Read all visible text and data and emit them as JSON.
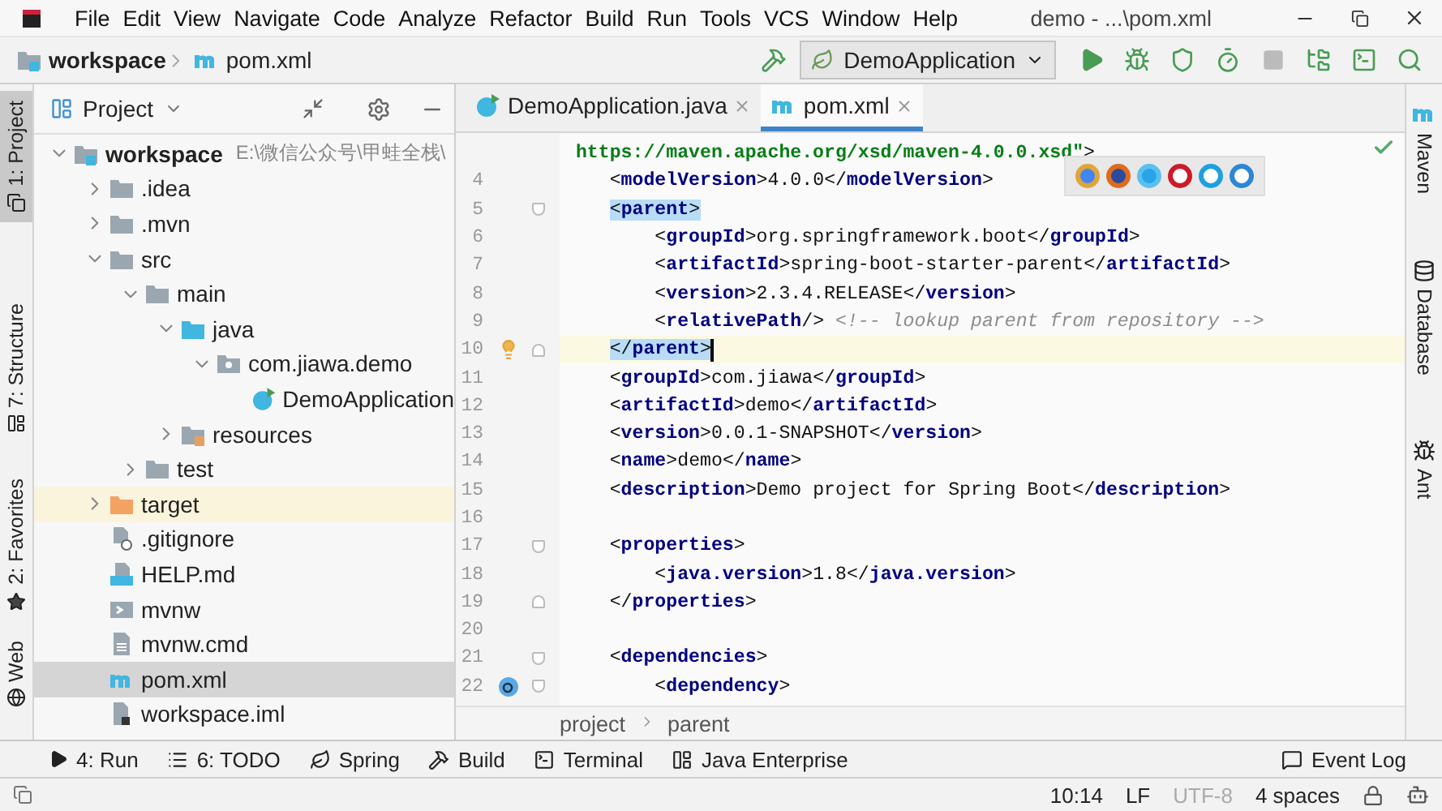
{
  "window": {
    "title": "demo - ...\\pom.xml"
  },
  "menu": [
    "File",
    "Edit",
    "View",
    "Navigate",
    "Code",
    "Analyze",
    "Refactor",
    "Build",
    "Run",
    "Tools",
    "VCS",
    "Window",
    "Help"
  ],
  "breadcrumb": [
    {
      "label": "workspace",
      "kind": "module"
    },
    {
      "label": "pom.xml",
      "kind": "maven"
    }
  ],
  "run_config": {
    "label": "DemoApplication"
  },
  "toolbar": [
    {
      "kind": "run",
      "disabled": false
    },
    {
      "kind": "debug",
      "disabled": false
    },
    {
      "kind": "coverage",
      "disabled": false
    },
    {
      "kind": "profile",
      "disabled": false
    },
    {
      "kind": "stop",
      "disabled": true
    },
    {
      "kind": "structure",
      "disabled": false
    },
    {
      "kind": "terminal",
      "disabled": false
    },
    {
      "kind": "search",
      "disabled": false
    }
  ],
  "left_stripe": [
    {
      "label": "1: Project",
      "selected": true
    },
    {
      "label": "7: Structure",
      "selected": false
    },
    {
      "label": "2: Favorites",
      "selected": false
    },
    {
      "label": "Web",
      "selected": false
    }
  ],
  "right_stripe": [
    {
      "label": "Maven",
      "kind": "maven"
    },
    {
      "label": "Database",
      "kind": "database"
    },
    {
      "label": "Ant",
      "kind": "ant"
    }
  ],
  "project_panel": {
    "title": "Project",
    "tree": [
      {
        "label": "workspace",
        "path": "E:\\微信公众号\\甲蛙全栈\\",
        "kind": "module",
        "expanded": true,
        "selected": false,
        "children": [
          {
            "label": ".idea",
            "kind": "folder",
            "expanded": false,
            "selected": false
          },
          {
            "label": ".mvn",
            "kind": "folder",
            "expanded": false,
            "selected": false
          },
          {
            "label": "src",
            "kind": "folder",
            "expanded": true,
            "selected": false,
            "children": [
              {
                "label": "main",
                "kind": "folder",
                "expanded": true,
                "selected": false,
                "children": [
                  {
                    "label": "java",
                    "kind": "source",
                    "expanded": true,
                    "selected": false,
                    "children": [
                      {
                        "label": "com.jiawa.demo",
                        "kind": "package",
                        "expanded": true,
                        "selected": false,
                        "children": [
                          {
                            "label": "DemoApplication",
                            "kind": "class",
                            "selected": false
                          }
                        ]
                      }
                    ]
                  },
                  {
                    "label": "resources",
                    "kind": "resources",
                    "expanded": false,
                    "selected": false
                  }
                ]
              },
              {
                "label": "test",
                "kind": "folder",
                "expanded": false,
                "selected": false
              }
            ]
          },
          {
            "label": "target",
            "kind": "excluded",
            "expanded": false,
            "selected": false
          },
          {
            "label": ".gitignore",
            "kind": "ignore",
            "selected": false
          },
          {
            "label": "HELP.md",
            "kind": "markdown",
            "selected": false
          },
          {
            "label": "mvnw",
            "kind": "script",
            "selected": false
          },
          {
            "label": "mvnw.cmd",
            "kind": "file",
            "selected": false
          },
          {
            "label": "pom.xml",
            "kind": "maven",
            "selected": true
          },
          {
            "label": "workspace.iml",
            "kind": "iml",
            "selected": false
          }
        ]
      }
    ]
  },
  "editor_tabs": [
    {
      "label": "DemoApplication.java",
      "kind": "class",
      "selected": false
    },
    {
      "label": "pom.xml",
      "kind": "maven",
      "selected": true
    }
  ],
  "code_lines": [
    {
      "segments": [
        {
          "kind": "string",
          "text": " https://maven.apache.org/xsd/maven-4.0.0.xsd\""
        },
        {
          "kind": "punct",
          "text": ">"
        }
      ]
    },
    {
      "number": "4",
      "segments": [
        {
          "kind": "punct",
          "text": "    <"
        },
        {
          "kind": "tag",
          "text": "modelVersion"
        },
        {
          "kind": "punct",
          "text": ">"
        },
        {
          "kind": "text",
          "text": "4.0.0"
        },
        {
          "kind": "punct",
          "text": "</"
        },
        {
          "kind": "tag",
          "text": "modelVersion"
        },
        {
          "kind": "punct",
          "text": ">"
        }
      ]
    },
    {
      "number": "5",
      "fold_start": true,
      "segments": [
        {
          "kind": "punct",
          "text": "    <",
          "matched": true
        },
        {
          "kind": "tag",
          "text": "parent",
          "matched": true
        },
        {
          "kind": "punct",
          "text": ">",
          "matched": true
        }
      ]
    },
    {
      "number": "6",
      "segments": [
        {
          "kind": "punct",
          "text": "        <"
        },
        {
          "kind": "tag",
          "text": "groupId"
        },
        {
          "kind": "punct",
          "text": ">"
        },
        {
          "kind": "text",
          "text": "org.springframework.boot"
        },
        {
          "kind": "punct",
          "text": "</"
        },
        {
          "kind": "tag",
          "text": "groupId"
        },
        {
          "kind": "punct",
          "text": ">"
        }
      ]
    },
    {
      "number": "7",
      "segments": [
        {
          "kind": "punct",
          "text": "        <"
        },
        {
          "kind": "tag",
          "text": "artifactId"
        },
        {
          "kind": "punct",
          "text": ">"
        },
        {
          "kind": "text",
          "text": "spring-boot-starter-parent"
        },
        {
          "kind": "punct",
          "text": "</"
        },
        {
          "kind": "tag",
          "text": "artifactId"
        },
        {
          "kind": "punct",
          "text": ">"
        }
      ]
    },
    {
      "number": "8",
      "segments": [
        {
          "kind": "punct",
          "text": "        <"
        },
        {
          "kind": "tag",
          "text": "version"
        },
        {
          "kind": "punct",
          "text": ">"
        },
        {
          "kind": "text",
          "text": "2.3.4.RELEASE"
        },
        {
          "kind": "punct",
          "text": "</"
        },
        {
          "kind": "tag",
          "text": "version"
        },
        {
          "kind": "punct",
          "text": ">"
        }
      ]
    },
    {
      "number": "9",
      "segments": [
        {
          "kind": "punct",
          "text": "        <"
        },
        {
          "kind": "tag",
          "text": "relativePath"
        },
        {
          "kind": "punct",
          "text": "/> "
        },
        {
          "kind": "comment",
          "text": "<!-- lookup parent from repository -->"
        }
      ]
    },
    {
      "number": "10",
      "fold_end": true,
      "bulb": true,
      "current": true,
      "caret": true,
      "segments": [
        {
          "kind": "punct",
          "text": "    </",
          "matched": true
        },
        {
          "kind": "tag",
          "text": "parent",
          "matched": true
        },
        {
          "kind": "punct",
          "text": ">",
          "matched": true
        }
      ]
    },
    {
      "number": "11",
      "segments": [
        {
          "kind": "punct",
          "text": "    <"
        },
        {
          "kind": "tag",
          "text": "groupId"
        },
        {
          "kind": "punct",
          "text": ">"
        },
        {
          "kind": "text",
          "text": "com.jiawa"
        },
        {
          "kind": "punct",
          "text": "</"
        },
        {
          "kind": "tag",
          "text": "groupId"
        },
        {
          "kind": "punct",
          "text": ">"
        }
      ]
    },
    {
      "number": "12",
      "segments": [
        {
          "kind": "punct",
          "text": "    <"
        },
        {
          "kind": "tag",
          "text": "artifactId"
        },
        {
          "kind": "punct",
          "text": ">"
        },
        {
          "kind": "text",
          "text": "demo"
        },
        {
          "kind": "punct",
          "text": "</"
        },
        {
          "kind": "tag",
          "text": "artifactId"
        },
        {
          "kind": "punct",
          "text": ">"
        }
      ]
    },
    {
      "number": "13",
      "segments": [
        {
          "kind": "punct",
          "text": "    <"
        },
        {
          "kind": "tag",
          "text": "version"
        },
        {
          "kind": "punct",
          "text": ">"
        },
        {
          "kind": "text",
          "text": "0.0.1-SNAPSHOT"
        },
        {
          "kind": "punct",
          "text": "</"
        },
        {
          "kind": "tag",
          "text": "version"
        },
        {
          "kind": "punct",
          "text": ">"
        }
      ]
    },
    {
      "number": "14",
      "segments": [
        {
          "kind": "punct",
          "text": "    <"
        },
        {
          "kind": "tag",
          "text": "name"
        },
        {
          "kind": "punct",
          "text": ">"
        },
        {
          "kind": "text",
          "text": "demo"
        },
        {
          "kind": "punct",
          "text": "</"
        },
        {
          "kind": "tag",
          "text": "name"
        },
        {
          "kind": "punct",
          "text": ">"
        }
      ]
    },
    {
      "number": "15",
      "segments": [
        {
          "kind": "punct",
          "text": "    <"
        },
        {
          "kind": "tag",
          "text": "description"
        },
        {
          "kind": "punct",
          "text": ">"
        },
        {
          "kind": "text",
          "text": "Demo project for Spring Boot"
        },
        {
          "kind": "punct",
          "text": "</"
        },
        {
          "kind": "tag",
          "text": "description"
        },
        {
          "kind": "punct",
          "text": ">"
        }
      ]
    },
    {
      "number": "16"
    },
    {
      "number": "17",
      "fold_start": true,
      "segments": [
        {
          "kind": "punct",
          "text": "    <"
        },
        {
          "kind": "tag",
          "text": "properties"
        },
        {
          "kind": "punct",
          "text": ">"
        }
      ]
    },
    {
      "number": "18",
      "segments": [
        {
          "kind": "punct",
          "text": "        <"
        },
        {
          "kind": "tag",
          "text": "java.version"
        },
        {
          "kind": "punct",
          "text": ">"
        },
        {
          "kind": "text",
          "text": "1.8"
        },
        {
          "kind": "punct",
          "text": "</"
        },
        {
          "kind": "tag",
          "text": "java.version"
        },
        {
          "kind": "punct",
          "text": ">"
        }
      ]
    },
    {
      "number": "19",
      "fold_end": true,
      "segments": [
        {
          "kind": "punct",
          "text": "    </"
        },
        {
          "kind": "tag",
          "text": "properties"
        },
        {
          "kind": "punct",
          "text": ">"
        }
      ]
    },
    {
      "number": "20"
    },
    {
      "number": "21",
      "fold_start": true,
      "segments": [
        {
          "kind": "punct",
          "text": "    <"
        },
        {
          "kind": "tag",
          "text": "dependencies"
        },
        {
          "kind": "punct",
          "text": ">"
        }
      ]
    },
    {
      "number": "22",
      "fold_start": true,
      "override": true,
      "segments": [
        {
          "kind": "punct",
          "text": "        <"
        },
        {
          "kind": "tag",
          "text": "dependency"
        },
        {
          "kind": "punct",
          "text": ">"
        }
      ]
    }
  ],
  "editor_breadcrumb": [
    "project",
    "parent"
  ],
  "tool_windows": [
    {
      "label": "4: Run",
      "kind": "run"
    },
    {
      "label": "6: TODO",
      "kind": "list"
    },
    {
      "label": "Spring",
      "kind": "leaf"
    },
    {
      "label": "Build",
      "kind": "hammer"
    },
    {
      "label": "Terminal",
      "kind": "terminal"
    },
    {
      "label": "Java Enterprise",
      "kind": "enterprise"
    }
  ],
  "event_log": {
    "label": "Event Log"
  },
  "status_bar": [
    {
      "label": "10:14",
      "disabled": false
    },
    {
      "label": "LF",
      "disabled": false
    },
    {
      "label": "UTF-8",
      "disabled": true
    },
    {
      "label": "4 spaces",
      "disabled": false
    }
  ]
}
